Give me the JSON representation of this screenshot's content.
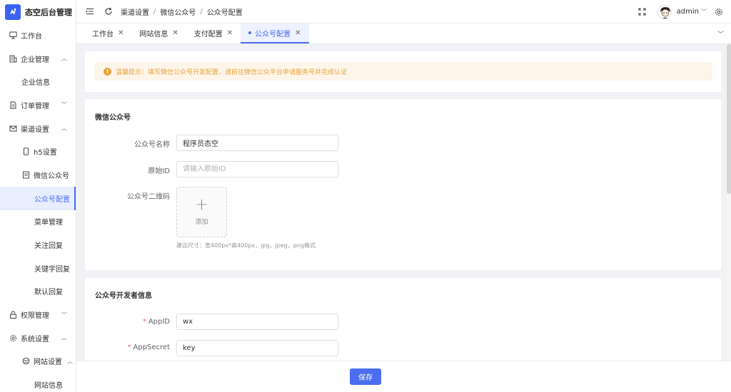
{
  "app": {
    "title": "态空后台管理"
  },
  "sidebar": {
    "items": [
      {
        "label": "工作台"
      },
      {
        "label": "企业管理"
      },
      {
        "label": "企业信息"
      },
      {
        "label": "订单管理"
      },
      {
        "label": "渠道设置"
      },
      {
        "label": "h5设置"
      },
      {
        "label": "微信公众号"
      },
      {
        "label": "公众号配置"
      },
      {
        "label": "菜单管理"
      },
      {
        "label": "关注回复"
      },
      {
        "label": "关键字回复"
      },
      {
        "label": "默认回复"
      },
      {
        "label": "权限管理"
      },
      {
        "label": "系统设置"
      },
      {
        "label": "网站设置"
      },
      {
        "label": "网站信息"
      }
    ]
  },
  "header": {
    "breadcrumb": [
      "渠道设置",
      "微信公众号",
      "公众号配置"
    ],
    "separator": "/",
    "user": "admin"
  },
  "tabs": [
    {
      "label": "工作台"
    },
    {
      "label": "网站信息"
    },
    {
      "label": "支付配置"
    },
    {
      "label": "公众号配置"
    }
  ],
  "alert": {
    "text": "温馨提示：填写微信公众号开发配置，请前往微信公众平台申请服务号并完成认证"
  },
  "section1": {
    "title": "微信公众号",
    "name_label": "公众号名称",
    "name_value": "程序员态空",
    "origin_label": "原始ID",
    "origin_placeholder": "请输入原始ID",
    "qr_label": "公众号二维码",
    "upload_label": "添加",
    "hint": "建议尺寸：宽400px*高400px，jpg，jpeg，png格式"
  },
  "section2": {
    "title": "公众号开发者信息",
    "appid_label": "AppID",
    "appid_value": "wx",
    "secret_label": "AppSecret",
    "secret_value": "key",
    "required_mark": "*"
  },
  "footer": {
    "save_label": "保存"
  },
  "colors": {
    "accent": "#4b6df0",
    "warning": "#e6a23c",
    "required": "#f56c6c"
  },
  "icons": {
    "collapse": "menu-fold-icon",
    "refresh": "refresh-icon",
    "fullscreen": "fullscreen-icon",
    "settings": "gear-icon"
  }
}
